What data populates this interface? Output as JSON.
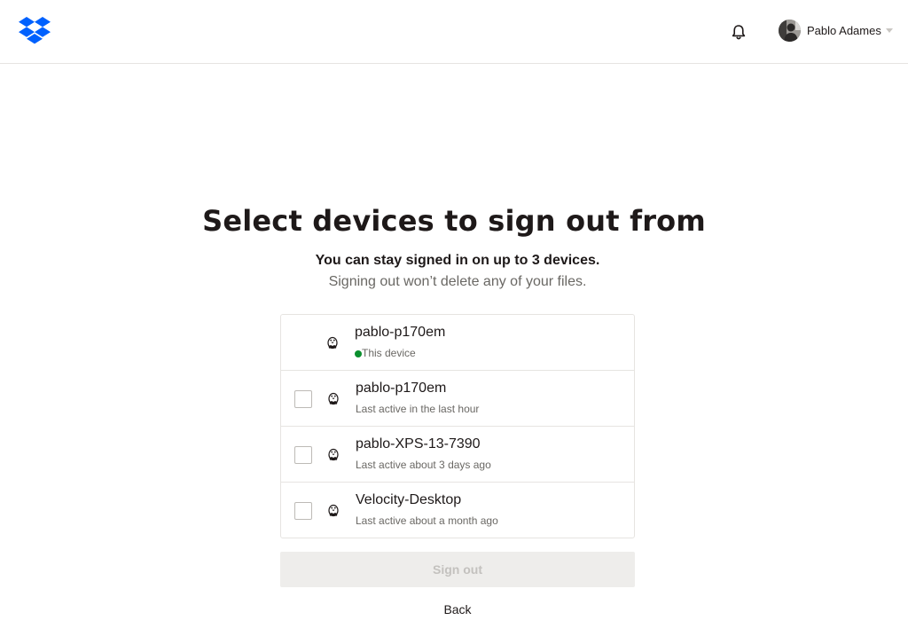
{
  "header": {
    "logo_icon": "dropbox-logo",
    "notifications_icon": "bell-icon",
    "account_name": "Pablo Adames",
    "brand_color": "#0061fe"
  },
  "page": {
    "title": "Select devices to sign out from",
    "subtitle": "You can stay signed in on up to 3 devices.",
    "note": "Signing out won’t delete any of your files."
  },
  "devices": [
    {
      "name": "pablo-p170em",
      "status": "This device",
      "current": true,
      "icon": "linux-penguin-icon"
    },
    {
      "name": "pablo-p170em",
      "status": "Last active in the last hour",
      "checked": false,
      "icon": "linux-penguin-icon"
    },
    {
      "name": "pablo-XPS-13-7390",
      "status": "Last active about 3 days ago",
      "checked": false,
      "icon": "linux-penguin-icon"
    },
    {
      "name": "Velocity-Desktop",
      "status": "Last active about a month ago",
      "checked": false,
      "icon": "linux-penguin-icon"
    }
  ],
  "actions": {
    "sign_out_label": "Sign out",
    "sign_out_disabled": true,
    "back_label": "Back"
  }
}
